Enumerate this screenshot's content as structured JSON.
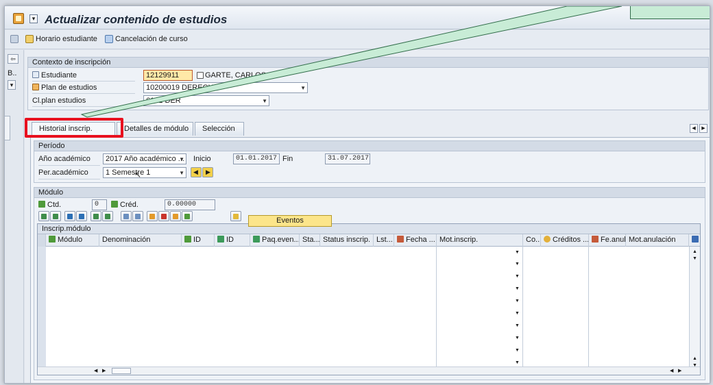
{
  "window": {
    "title": "Actualizar contenido de estudios"
  },
  "toolbar": {
    "schedule_label": "Horario estudiante",
    "cancel_label": "Cancelación de curso"
  },
  "leftstrip": {
    "b_label": "B.."
  },
  "context": {
    "group_title": "Contexto de inscripción",
    "student_label": "Estudiante",
    "student_id": "12129911",
    "student_name": "GARTE, CARLOS",
    "plan_label": "Plan de estudios",
    "plan_value": "10200019 DERECHO",
    "clplan_label": "Cl.plan estudios",
    "clplan_value": "6101 DER"
  },
  "tabs": [
    {
      "label": "Historial inscrip."
    },
    {
      "label": "Detalles de módulo"
    },
    {
      "label": "Selección"
    }
  ],
  "periodo": {
    "group_title": "Período",
    "year_label": "Año académico",
    "year_value": "2017 Año académico ...",
    "inicio_label": "Inicio",
    "inicio_value": "01.01.2017",
    "fin_label": "Fin",
    "fin_value": "31.07.2017",
    "per_label": "Per.académico",
    "per_value": "1 Semestre 1"
  },
  "modulo": {
    "group_title": "Módulo",
    "ctd_label": "Ctd.",
    "ctd_value": "0",
    "cred_label": "Créd.",
    "cred_value": "0.00000",
    "eventos_label": "Eventos",
    "grid_title": "Inscrip.módulo",
    "columns": [
      "Módulo",
      "Denominación",
      "ID",
      "ID",
      "Paq.even...",
      "Sta...",
      "Status inscrip.",
      "Lst...",
      "Fecha ...",
      "Mot.inscrip.",
      "Co...",
      "Créditos ...",
      "Fe.anul.",
      "Mot.anulación"
    ]
  }
}
